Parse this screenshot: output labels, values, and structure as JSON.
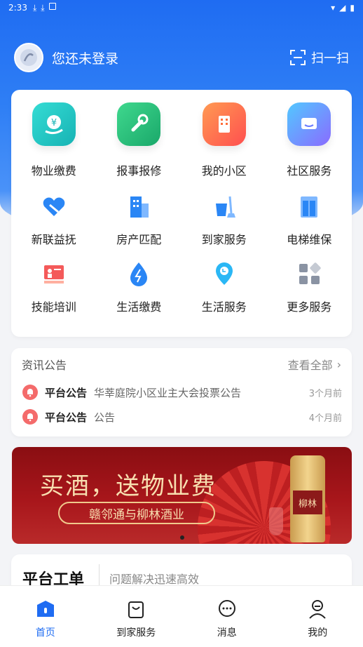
{
  "status_bar": {
    "time": "2:33"
  },
  "header": {
    "login_text": "您还未登录",
    "scan_label": "扫一扫"
  },
  "main_services": [
    {
      "label": "物业缴费",
      "icon": "property-fee-icon",
      "color": "#1ec8c0"
    },
    {
      "label": "报事报修",
      "icon": "repair-icon",
      "color": "#25c07a"
    },
    {
      "label": "我的小区",
      "icon": "building-icon",
      "color": "#ff6d3a"
    },
    {
      "label": "社区服务",
      "icon": "chat-icon",
      "color": "#5b7bff"
    }
  ],
  "more_services_row1": [
    {
      "label": "新联益抚",
      "icon": "heart-hand-icon"
    },
    {
      "label": "房产匹配",
      "icon": "apartment-icon"
    },
    {
      "label": "到家服务",
      "icon": "cleaning-icon"
    },
    {
      "label": "电梯维保",
      "icon": "elevator-icon"
    }
  ],
  "more_services_row2": [
    {
      "label": "技能培训",
      "icon": "training-icon"
    },
    {
      "label": "生活缴费",
      "icon": "water-drop-icon"
    },
    {
      "label": "生活服务",
      "icon": "location-service-icon"
    },
    {
      "label": "更多服务",
      "icon": "more-grid-icon"
    }
  ],
  "news": {
    "title": "资讯公告",
    "view_all": "查看全部",
    "items": [
      {
        "tag": "平台公告",
        "text": "华莘庭院小区业主大会投票公告",
        "time": "3个月前"
      },
      {
        "tag": "平台公告",
        "text": "公告",
        "time": "4个月前"
      }
    ]
  },
  "banner": {
    "title": "买酒，送物业费",
    "subtitle": "赣邻通与柳林酒业",
    "bottle_label": "柳林"
  },
  "work_order": {
    "title": "平台工单",
    "subtitle": "问题解决迅速高效"
  },
  "tabbar": [
    {
      "label": "首页",
      "icon": "home-icon",
      "active": true
    },
    {
      "label": "到家服务",
      "icon": "bag-icon",
      "active": false
    },
    {
      "label": "消息",
      "icon": "message-icon",
      "active": false
    },
    {
      "label": "我的",
      "icon": "user-icon",
      "active": false
    }
  ],
  "colors": {
    "primary": "#1f6cf2",
    "banner_red": "#a8161b",
    "bell_red": "#f46b6b"
  }
}
